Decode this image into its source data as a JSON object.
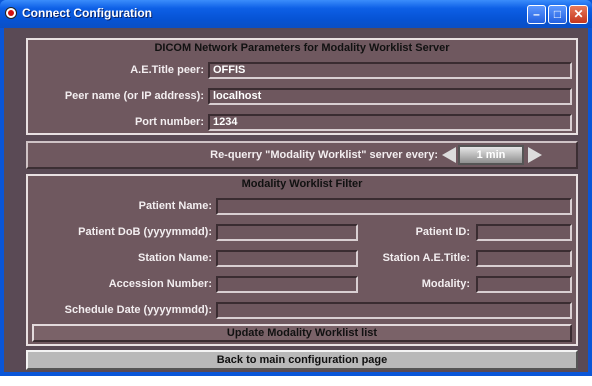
{
  "window": {
    "title": "Connect Configuration"
  },
  "network": {
    "title": "DICOM Network Parameters for Modality Worklist Server",
    "ae_title_label": "A.E.Title peer:",
    "ae_title_value": "OFFIS",
    "peer_label": "Peer name (or IP address):",
    "peer_value": "localhost",
    "port_label": "Port number:",
    "port_value": "1234"
  },
  "requery": {
    "label": "Re-querry \"Modality Worklist\" server every:",
    "value": "1 min"
  },
  "filter": {
    "title": "Modality Worklist Filter",
    "patient_name_label": "Patient Name:",
    "patient_name_value": "",
    "dob_label": "Patient DoB (yyyymmdd):",
    "dob_value": "",
    "patient_id_label": "Patient ID:",
    "patient_id_value": "",
    "station_name_label": "Station Name:",
    "station_name_value": "",
    "station_ae_label": "Station A.E.Title:",
    "station_ae_value": "",
    "accession_label": "Accession Number:",
    "accession_value": "",
    "modality_label": "Modality:",
    "modality_value": "",
    "schedule_label": "Schedule Date (yyyymmdd):",
    "schedule_value": "",
    "update_button": "Update Modality Worklist list"
  },
  "footer": {
    "back_button": "Back to main configuration page"
  }
}
